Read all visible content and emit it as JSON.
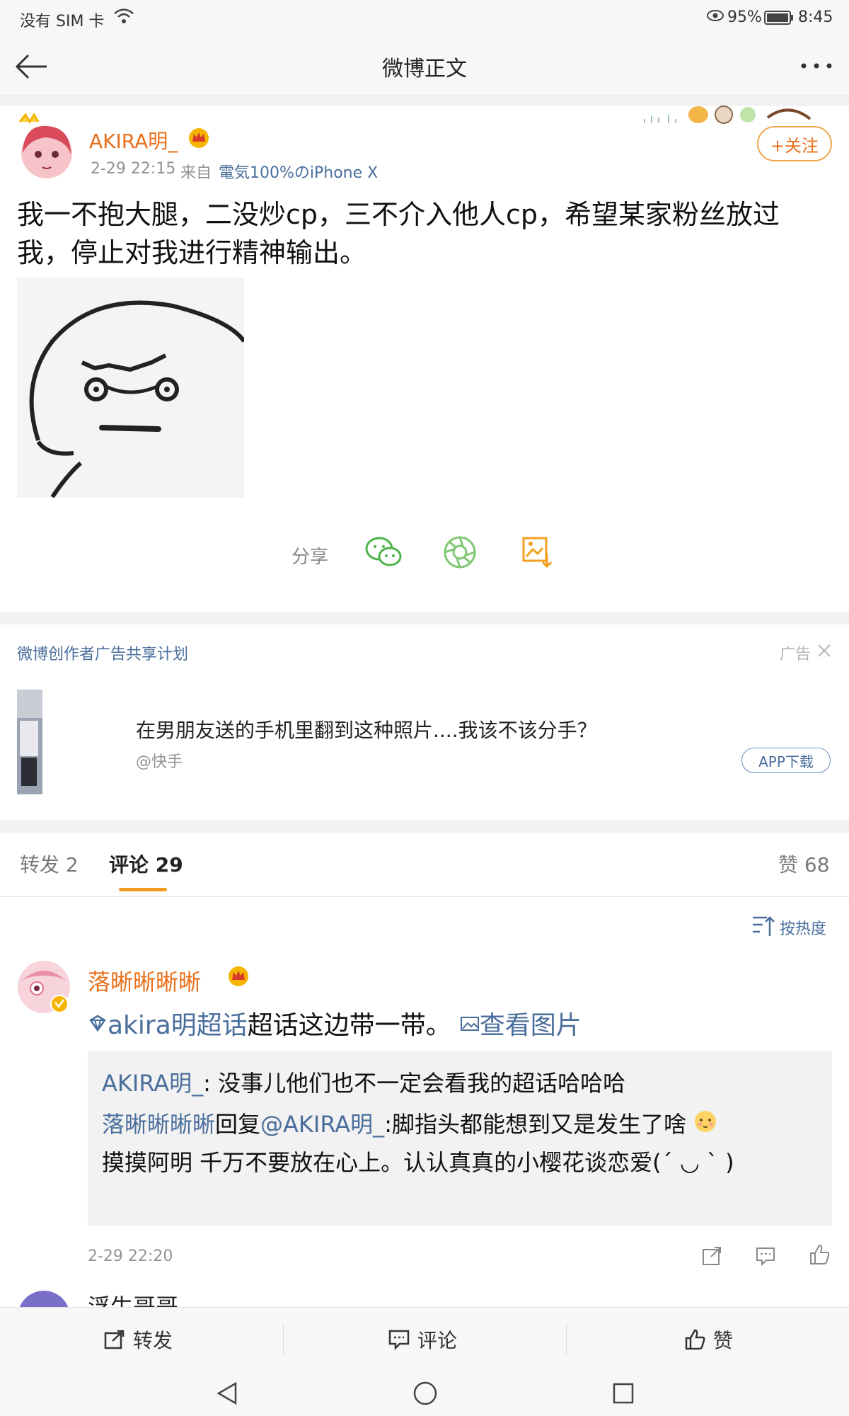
{
  "status_bar": {
    "carrier": "没有 SIM 卡",
    "battery": "95%",
    "time": "8:45"
  },
  "nav": {
    "title": "微博正文"
  },
  "post": {
    "author": "AKIRA明_",
    "time": "2-29 22:15",
    "source_prefix": "来自",
    "source": "電気100%のiPhone X",
    "follow_label": "+关注",
    "text": "我一不抱大腿，二没炒cp，三不介入他人cp，希望某家粉丝放过我，停止对我进行精神输出。",
    "share_label": "分享"
  },
  "ad": {
    "program": "微博创作者广告共享计划",
    "badge": "广告",
    "headline": "在男朋友送的手机里翻到这种照片....我该不该分手？",
    "source": "@快手",
    "cta": "APP下载"
  },
  "tabs": {
    "repost": "转发 2",
    "comment": "评论 29",
    "like": "赞 68"
  },
  "sort_label": "按热度",
  "comment": {
    "author": "落晰晰晰晰",
    "topic": "akira明超话",
    "text": " 超话这边带一带。",
    "image_link": "查看图片",
    "replies": [
      {
        "author": "AKIRA明_",
        "text": ": 没事儿他们也不一定会看我的超话哈哈哈"
      },
      {
        "author": "落晰晰晰晰",
        "mid": "回复",
        "mention": "@AKIRA明_",
        "text": ":脚指头都能想到又是发生了啥",
        "text2": "摸摸阿明 千万不要放在心上。认认真真的小樱花谈恋爱(´ ◡ ` )"
      }
    ],
    "time": "2-29 22:20"
  },
  "next_comment_author": "浮生哥哥",
  "bottom": {
    "repost": "转发",
    "comment": "评论",
    "like": "赞"
  },
  "colors": {
    "accent": "#e86f1a",
    "link": "#4a6e9c"
  }
}
